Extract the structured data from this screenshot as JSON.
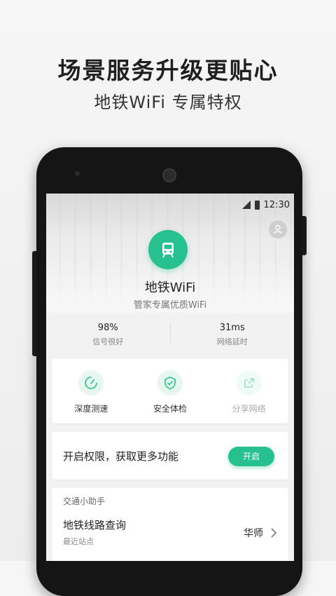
{
  "promo": {
    "headline": "场景服务升级更贴心",
    "subline": "地铁WiFi  专属特权"
  },
  "status_bar": {
    "time": "12:30"
  },
  "hero": {
    "title": "地铁WiFi",
    "subtitle": "管家专属优质WiFi"
  },
  "stats": [
    {
      "value": "98%",
      "label": "信号很好"
    },
    {
      "value": "31ms",
      "label": "网络延时"
    }
  ],
  "tools": [
    {
      "label": "深度测速",
      "icon": "speedometer-icon"
    },
    {
      "label": "安全体检",
      "icon": "shield-check-icon"
    },
    {
      "label": "分享网络",
      "icon": "share-icon"
    }
  ],
  "permission": {
    "text": "开启权限，获取更多功能",
    "button": "开启"
  },
  "helper": {
    "title": "交通小助手",
    "item_title": "地铁线路查询",
    "item_sub": "最近站点",
    "item_value": "华师"
  },
  "colors": {
    "accent": "#27c08f"
  }
}
